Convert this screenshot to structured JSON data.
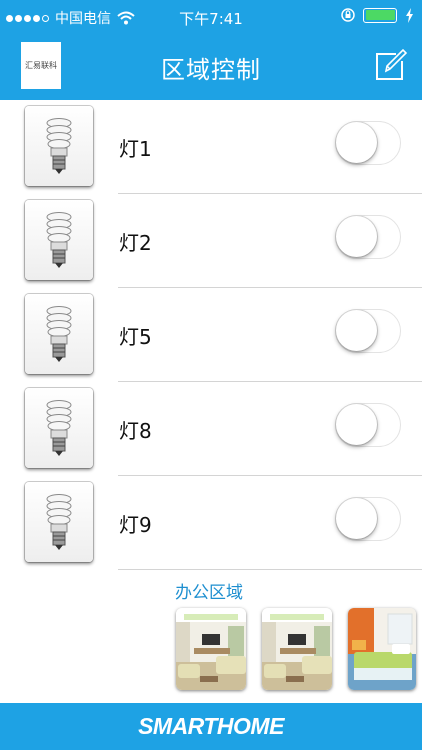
{
  "status_bar": {
    "carrier": "中国电信",
    "time": "下午7:41",
    "signal_bars": 4,
    "signal_total": 5,
    "battery_level": 1.0,
    "battery_color": "#4cd964"
  },
  "nav": {
    "logo_text": "汇易联科",
    "title": "区域控制",
    "edit_icon": "edit-icon",
    "color": "#1ea2e4"
  },
  "devices": [
    {
      "label": "灯1",
      "icon": "light-bulb-icon",
      "on": false
    },
    {
      "label": "灯2",
      "icon": "light-bulb-icon",
      "on": false
    },
    {
      "label": "灯5",
      "icon": "light-bulb-icon",
      "on": false
    },
    {
      "label": "灯8",
      "icon": "light-bulb-icon",
      "on": false
    },
    {
      "label": "灯9",
      "icon": "light-bulb-icon",
      "on": false
    }
  ],
  "area": {
    "title": "办公区域",
    "thumbnails": [
      "living-room-thumbnail",
      "living-room-thumbnail",
      "bedroom-thumbnail"
    ]
  },
  "footer": {
    "brand": "SMARTHOME"
  }
}
